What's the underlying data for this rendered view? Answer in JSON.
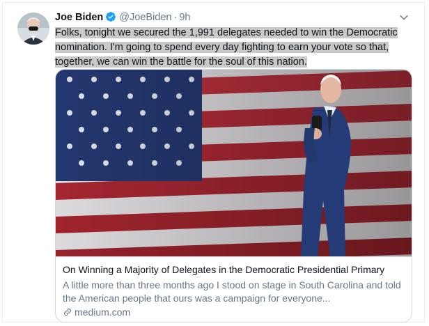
{
  "author": {
    "name": "Joe Biden",
    "handle": "@JoeBiden",
    "separator": "·",
    "time": "9h"
  },
  "tweet": {
    "line1": "Folks, tonight we secured the 1,991 delegates needed to win the Democratic",
    "line2": "nomination. I'm going to spend every day fighting to earn your vote so that,",
    "line3": "together, we can win the battle for the soul of this nation."
  },
  "card": {
    "title": "On Winning a Majority of Delegates in the Democratic Presidential Primary",
    "description": "A little more than three months ago I stood on stage in South Carolina and told the American people that ours was a campaign for everyone...",
    "domain": "medium.com"
  },
  "colors": {
    "verified": "#1da1f2",
    "secondary_text": "#657786",
    "highlight": "#c9c9c9"
  },
  "icons": [
    "verified-badge-icon",
    "chevron-down-icon",
    "link-icon"
  ]
}
